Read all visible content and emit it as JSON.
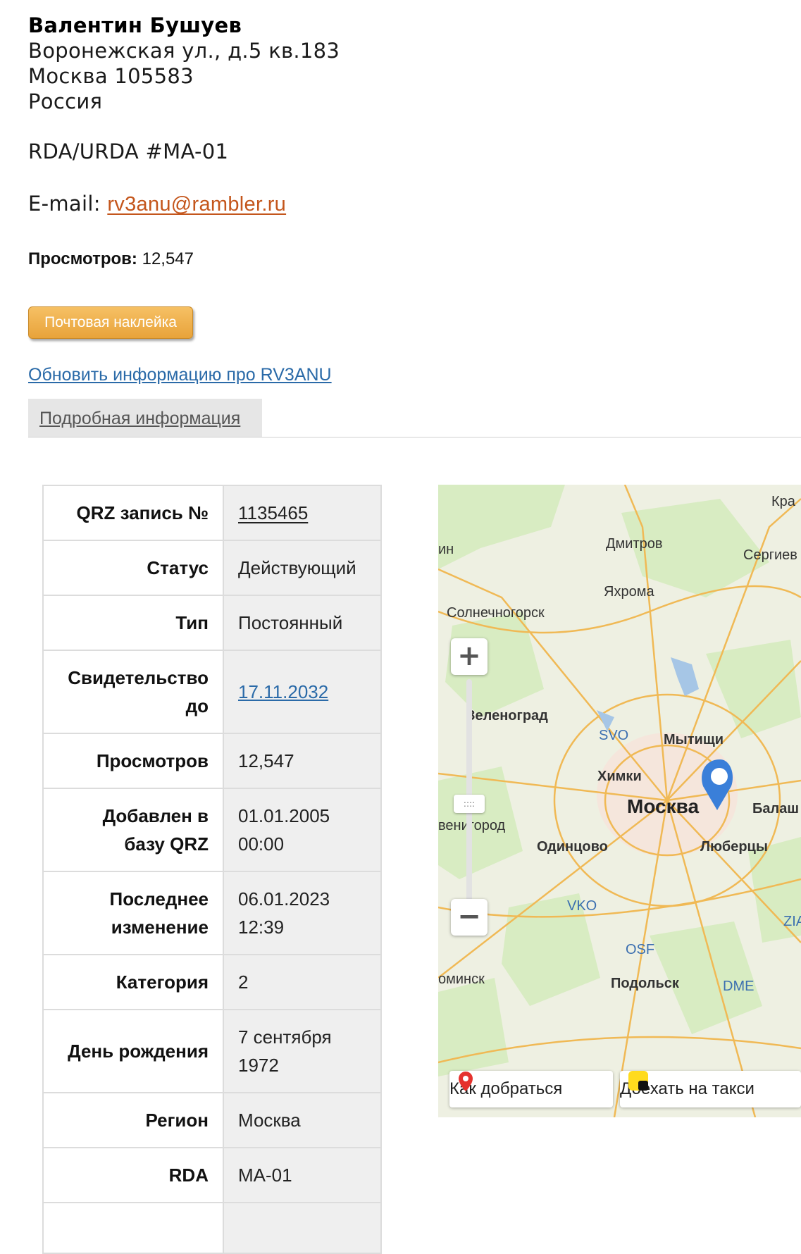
{
  "address": {
    "name": "Валентин Бушуев",
    "street": "Воронежская ул., д.5 кв.183",
    "city": "Москва 105583",
    "country": "Россия"
  },
  "rda_line": "RDA/URDA #MA-01",
  "email": {
    "label": "E-mail:",
    "value": "rv3anu@rambler.ru"
  },
  "views": {
    "label": "Просмотров:",
    "value": "12,547"
  },
  "buttons": {
    "mail_label": "Почтовая наклейка"
  },
  "update_link": "Обновить информацию про RV3ANU",
  "tab_label": "Подробная информация",
  "table": {
    "rows": [
      {
        "key": "QRZ запись №",
        "value": "1135465"
      },
      {
        "key": "Статус",
        "value": "Действующий"
      },
      {
        "key": "Тип",
        "value": "Постоянный"
      },
      {
        "key": "Свидетельство до",
        "value": "17.11.2032"
      },
      {
        "key": "Просмотров",
        "value": "12,547"
      },
      {
        "key": "Добавлен в базу QRZ",
        "value": "01.01.2005 00:00"
      },
      {
        "key": "Последнее изменение",
        "value": "06.01.2023 12:39"
      },
      {
        "key": "Категория",
        "value": "2"
      },
      {
        "key": "День рождения",
        "value": "7 сентября 1972"
      },
      {
        "key": "Регион",
        "value": "Москва"
      },
      {
        "key": "RDA",
        "value": "MA-01"
      }
    ]
  },
  "map": {
    "labels": {
      "dmitrov": "Дмитров",
      "yakhroma": "Яхрома",
      "solnechnogorsk": "Солнечногорск",
      "zelenograd": "Зеленоград",
      "svo": "SVO",
      "mytishchi": "Мытищи",
      "khimki": "Химки",
      "moskva": "Москва",
      "zvenigorod": "венигород",
      "odintsovo": "Одинцово",
      "lyubertsy": "Люберцы",
      "vko": "VKO",
      "osf": "OSF",
      "podolsk": "Подольск",
      "dme": "DME",
      "naro": "оминск",
      "sergiev": "Сергиев",
      "kra": "Кра",
      "balash": "Балаш",
      "zia": "ZIA",
      "in": "ин"
    },
    "zoom_in": "+",
    "zoom_out": "−",
    "route_button": "Как добраться",
    "taxi_button": "Доехать на такси",
    "colors": {
      "road": "#f0b955",
      "water": "#a6c6e6",
      "forest": "#d8ecc2",
      "city": "#f5e6dc",
      "pin": "#3a7fd9"
    }
  }
}
